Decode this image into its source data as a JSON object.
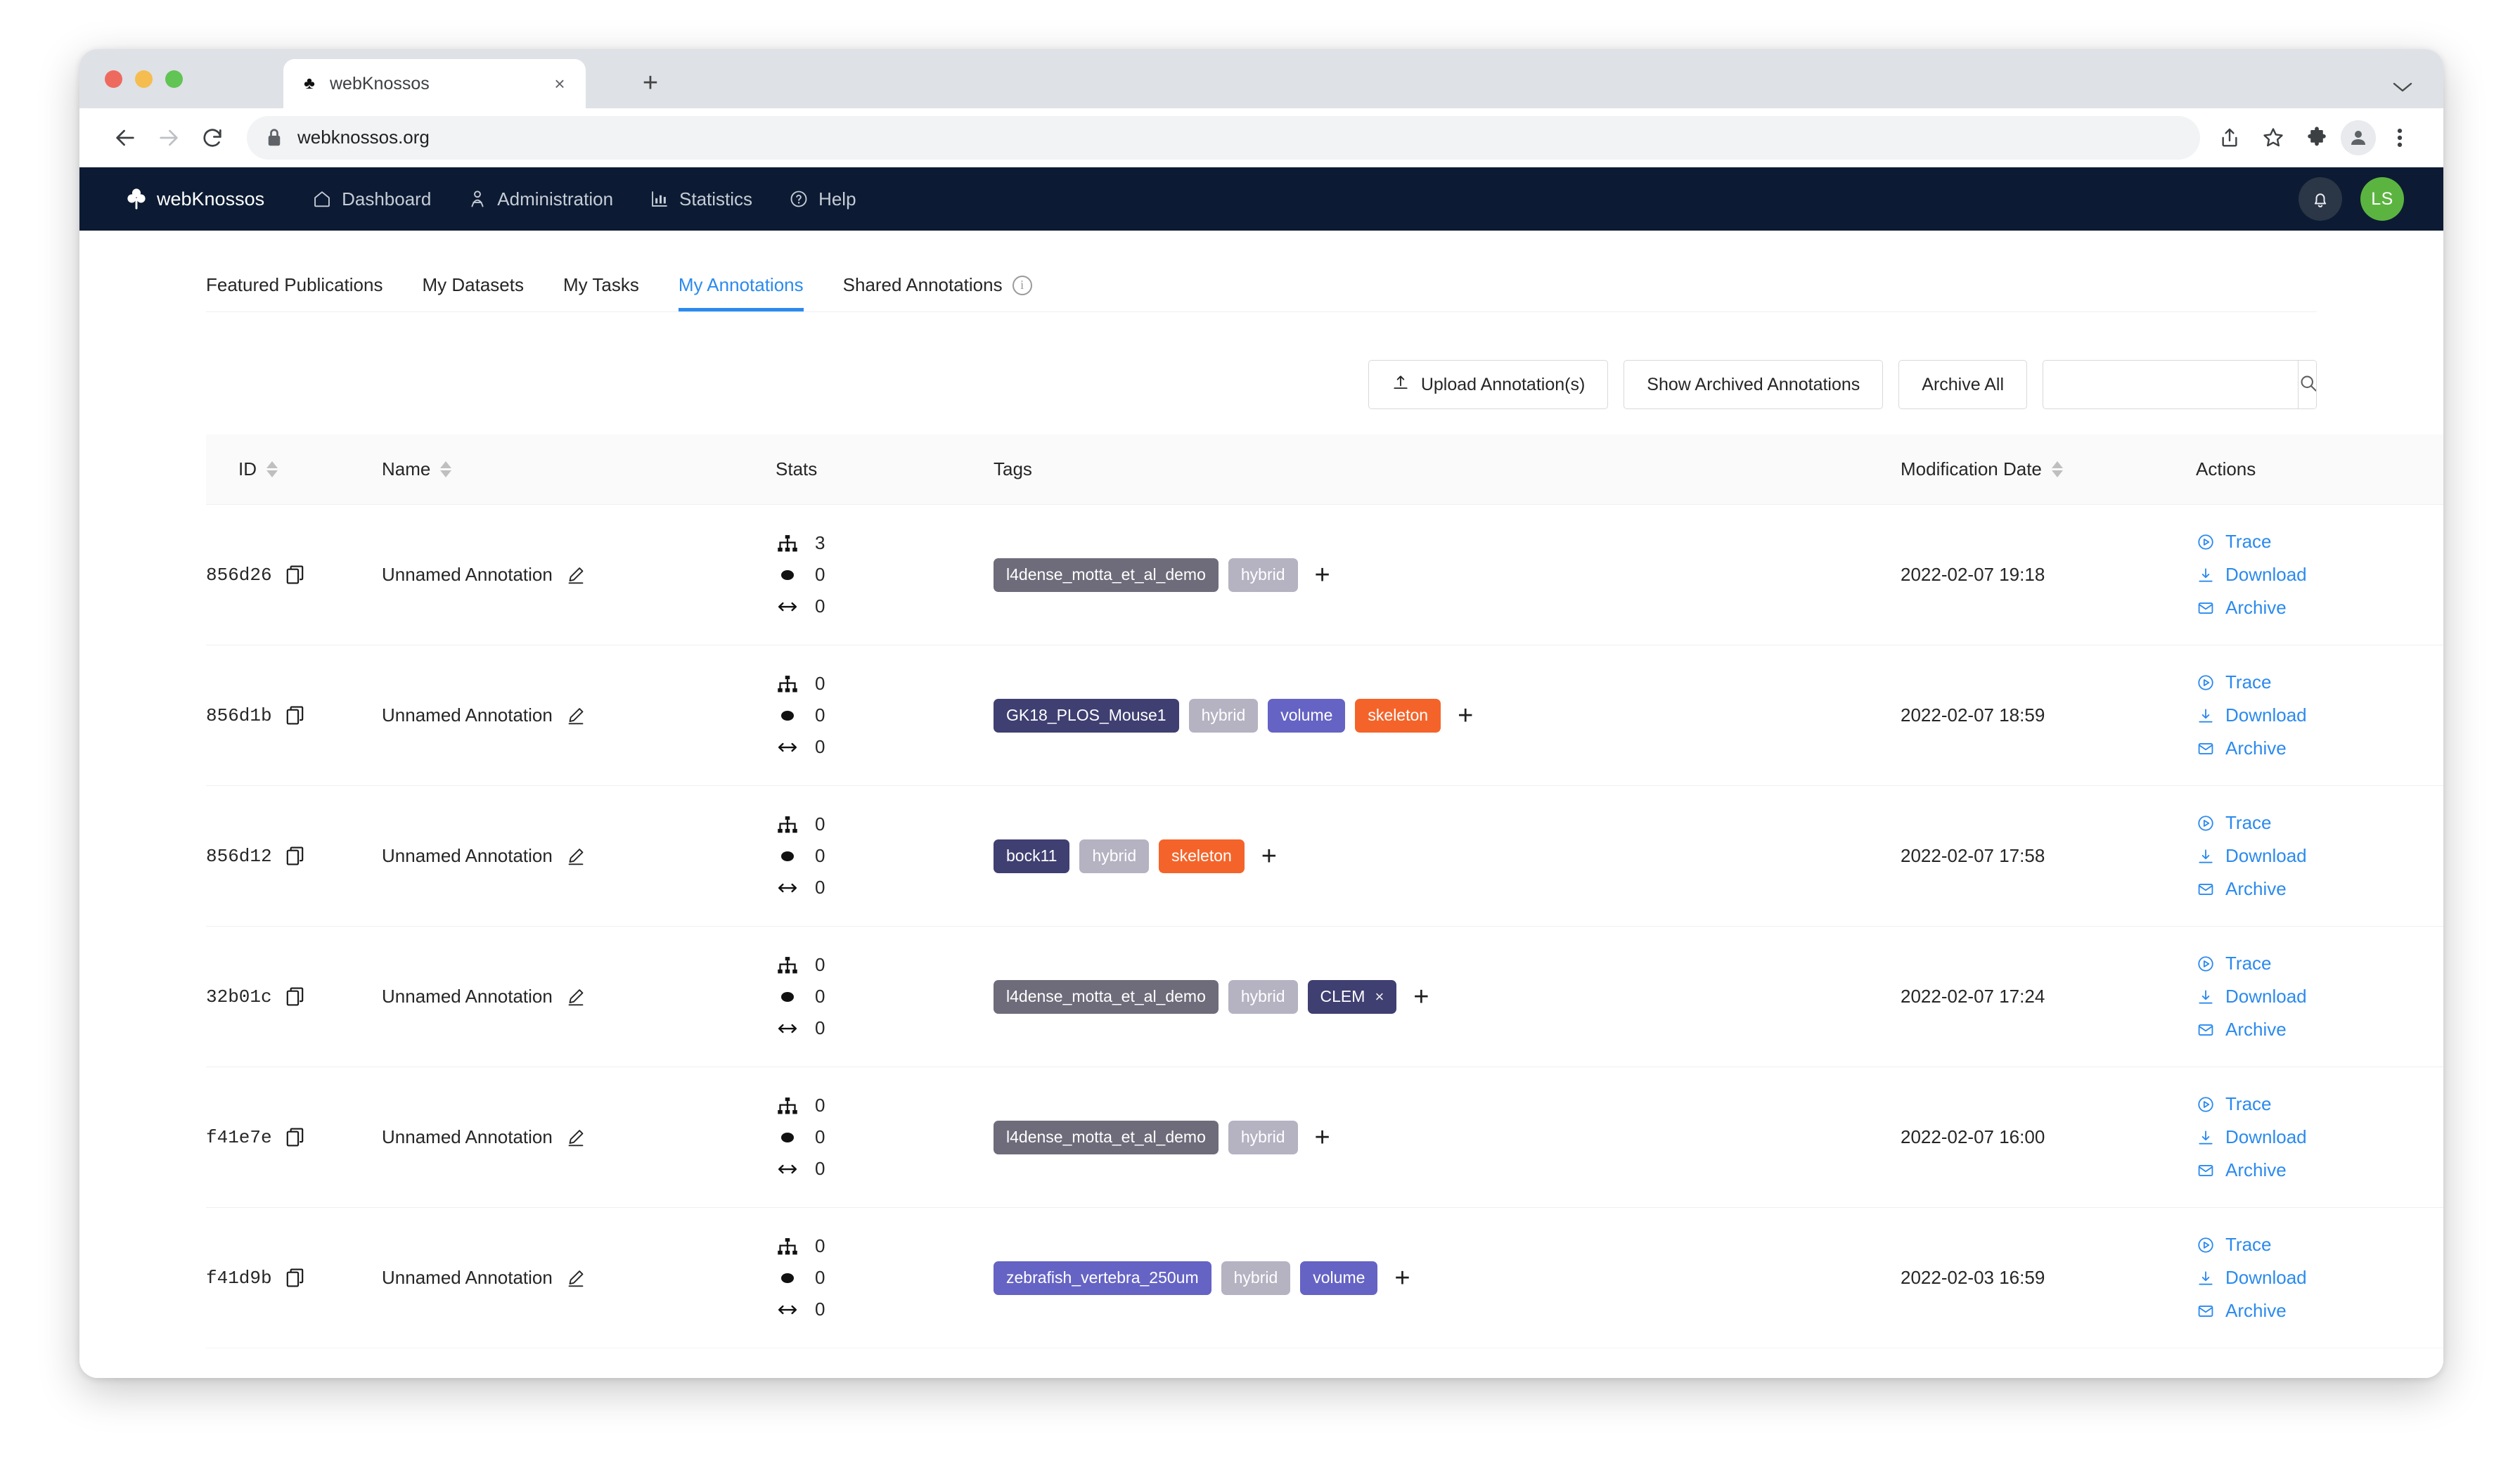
{
  "browser": {
    "tab": {
      "title": "webKnossos",
      "favicon": "clover-icon",
      "close_label": "×"
    },
    "new_tab_label": "+",
    "tabstrip_chevron": "⌄",
    "url": "webknossos.org",
    "back_label": "←",
    "forward_label": "→",
    "reload_label": "↻"
  },
  "app_nav": {
    "brand": "webKnossos",
    "items": [
      {
        "label": "Dashboard",
        "icon": "home-icon"
      },
      {
        "label": "Administration",
        "icon": "users-icon"
      },
      {
        "label": "Statistics",
        "icon": "bar-chart-icon"
      },
      {
        "label": "Help",
        "icon": "question-circle-icon"
      }
    ],
    "avatar_initials": "LS",
    "accent_dark": "#0c1b33",
    "avatar_color": "#5cb440"
  },
  "tabs": [
    {
      "label": "Featured Publications",
      "active": false
    },
    {
      "label": "My Datasets",
      "active": false
    },
    {
      "label": "My Tasks",
      "active": false
    },
    {
      "label": "My Annotations",
      "active": true
    },
    {
      "label": "Shared Annotations",
      "active": false,
      "info": true
    }
  ],
  "toolbar": {
    "upload_label": "Upload Annotation(s)",
    "show_archived_label": "Show Archived Annotations",
    "archive_all_label": "Archive All",
    "search_value": "",
    "search_placeholder": ""
  },
  "table": {
    "columns": [
      {
        "key": "id",
        "label": "ID",
        "sortable": true
      },
      {
        "key": "name",
        "label": "Name",
        "sortable": true
      },
      {
        "key": "stats",
        "label": "Stats",
        "sortable": false
      },
      {
        "key": "tags",
        "label": "Tags",
        "sortable": false
      },
      {
        "key": "date",
        "label": "Modification Date",
        "sortable": true
      },
      {
        "key": "actions",
        "label": "Actions",
        "sortable": false
      }
    ],
    "action_labels": {
      "trace": "Trace",
      "download": "Download",
      "archive": "Archive"
    },
    "tag_add_label": "+",
    "rows": [
      {
        "id": "856d26",
        "name": "Unnamed Annotation",
        "stats": {
          "trees": "3",
          "nodes": "0",
          "length": "0"
        },
        "tags": [
          {
            "label": "l4dense_motta_et_al_demo",
            "color": "#6e6c7a",
            "closable": false
          },
          {
            "label": "hybrid",
            "color": "#b5b2c2",
            "closable": false
          }
        ],
        "date": "2022-02-07 19:18"
      },
      {
        "id": "856d1b",
        "name": "Unnamed Annotation",
        "stats": {
          "trees": "0",
          "nodes": "0",
          "length": "0"
        },
        "tags": [
          {
            "label": "GK18_PLOS_Mouse1",
            "color": "#3f3f72",
            "closable": false
          },
          {
            "label": "hybrid",
            "color": "#b5b2c2",
            "closable": false
          },
          {
            "label": "volume",
            "color": "#6563c4",
            "closable": false
          },
          {
            "label": "skeleton",
            "color": "#f4642a",
            "closable": false
          }
        ],
        "date": "2022-02-07 18:59"
      },
      {
        "id": "856d12",
        "name": "Unnamed Annotation",
        "stats": {
          "trees": "0",
          "nodes": "0",
          "length": "0"
        },
        "tags": [
          {
            "label": "bock11",
            "color": "#3f3f72",
            "closable": false
          },
          {
            "label": "hybrid",
            "color": "#b5b2c2",
            "closable": false
          },
          {
            "label": "skeleton",
            "color": "#f4642a",
            "closable": false
          }
        ],
        "date": "2022-02-07 17:58"
      },
      {
        "id": "32b01c",
        "name": "Unnamed Annotation",
        "stats": {
          "trees": "0",
          "nodes": "0",
          "length": "0"
        },
        "tags": [
          {
            "label": "l4dense_motta_et_al_demo",
            "color": "#6e6c7a",
            "closable": false
          },
          {
            "label": "hybrid",
            "color": "#b5b2c2",
            "closable": false
          },
          {
            "label": "CLEM",
            "color": "#3f3f72",
            "closable": true
          }
        ],
        "date": "2022-02-07 17:24"
      },
      {
        "id": "f41e7e",
        "name": "Unnamed Annotation",
        "stats": {
          "trees": "0",
          "nodes": "0",
          "length": "0"
        },
        "tags": [
          {
            "label": "l4dense_motta_et_al_demo",
            "color": "#6e6c7a",
            "closable": false
          },
          {
            "label": "hybrid",
            "color": "#b5b2c2",
            "closable": false
          }
        ],
        "date": "2022-02-07 16:00"
      },
      {
        "id": "f41d9b",
        "name": "Unnamed Annotation",
        "stats": {
          "trees": "0",
          "nodes": "0",
          "length": "0"
        },
        "tags": [
          {
            "label": "zebrafish_vertebra_250um",
            "color": "#6563c4",
            "closable": false
          },
          {
            "label": "hybrid",
            "color": "#b5b2c2",
            "closable": false
          },
          {
            "label": "volume",
            "color": "#6563c4",
            "closable": false
          }
        ],
        "date": "2022-02-03 16:59"
      }
    ]
  }
}
